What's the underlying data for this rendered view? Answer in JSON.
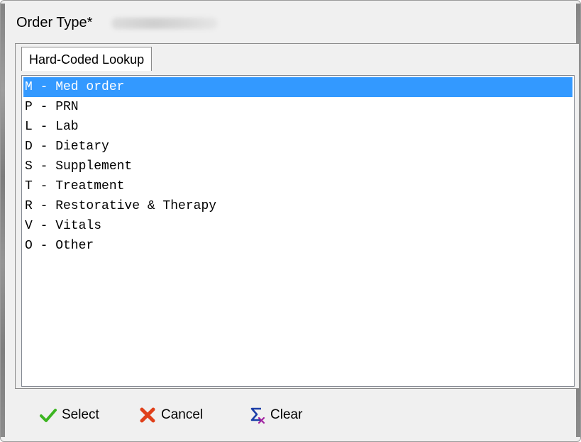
{
  "window": {
    "title": "Order Type*"
  },
  "tab": {
    "label": "Hard-Coded Lookup"
  },
  "list": {
    "selected_index": 0,
    "items": [
      "M - Med order",
      "P - PRN",
      "L - Lab",
      "D - Dietary",
      "S - Supplement",
      "T - Treatment",
      "R - Restorative & Therapy",
      "V - Vitals",
      "O - Other"
    ]
  },
  "buttons": {
    "select_label": "Select",
    "cancel_label": "Cancel",
    "clear_label": "Clear"
  },
  "colors": {
    "selection": "#3399ff"
  },
  "icons": {
    "select": "checkmark-icon",
    "cancel": "x-icon",
    "clear": "sigma-clear-icon"
  }
}
